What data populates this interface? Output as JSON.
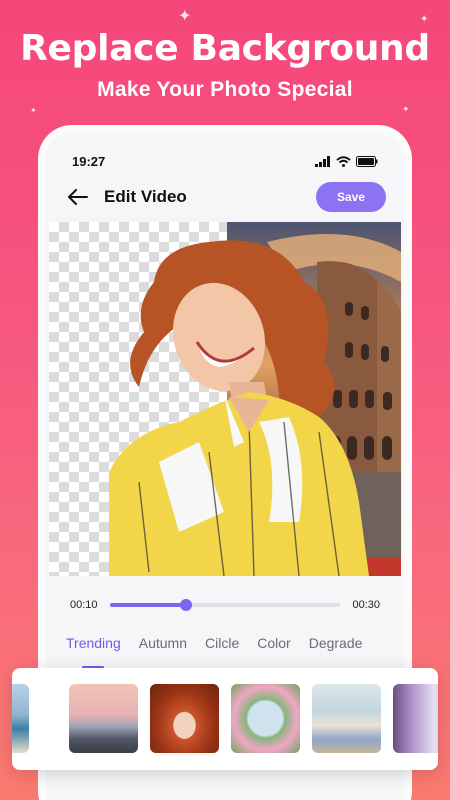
{
  "hero": {
    "title": "Replace Background",
    "subtitle": "Make Your Photo Special"
  },
  "status_bar": {
    "time": "19:27"
  },
  "app_bar": {
    "title": "Edit Video",
    "save_label": "Save"
  },
  "playback": {
    "current_time": "00:10",
    "end_time": "00:30",
    "progress": 0.33
  },
  "tabs": [
    {
      "label": "Trending",
      "active": true
    },
    {
      "label": "Autumn",
      "active": false
    },
    {
      "label": "Cilcle",
      "active": false
    },
    {
      "label": "Color",
      "active": false
    },
    {
      "label": "Degrade",
      "active": false
    }
  ],
  "backgrounds": [
    {
      "name": "beach-sea"
    },
    {
      "name": "sunset-beach-birds"
    },
    {
      "name": "rock-arch"
    },
    {
      "name": "flower-frame-lake"
    },
    {
      "name": "cozy-room"
    },
    {
      "name": "purple-interior"
    }
  ],
  "colors": {
    "accent": "#7b67ef",
    "save_button": "#8c73f3",
    "page_gradient_top": "#f5477a",
    "page_gradient_bottom": "#fa7a6f"
  }
}
